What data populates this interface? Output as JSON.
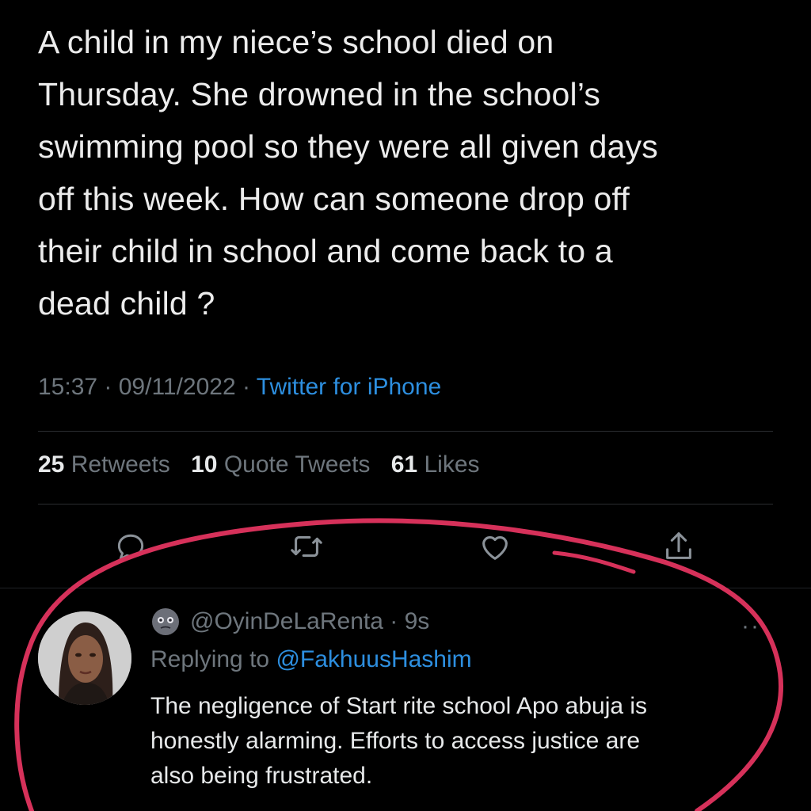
{
  "tweet": {
    "text_lines": [
      "A child in my niece’s school died on",
      "Thursday. She drowned in the school’s",
      "swimming pool so they were all given days",
      "off this week. How can someone drop off",
      "their child in school and come back to a",
      "dead child ?"
    ],
    "time": "15:37",
    "date": "09/11/2022",
    "separator": " · ",
    "source": "Twitter for iPhone",
    "stats": {
      "retweets_count": "25",
      "retweets_label": "Retweets",
      "quotes_count": "10",
      "quotes_label": "Quote Tweets",
      "likes_count": "61",
      "likes_label": "Likes"
    },
    "actions": [
      "reply-icon",
      "retweet-icon",
      "like-icon",
      "share-icon"
    ]
  },
  "reply": {
    "handle": "@OyinDeLaRenta",
    "age": "9s",
    "replying_label": "Replying to",
    "replying_to": "@FakhuusHashim",
    "more": "···",
    "text_lines": [
      "The negligence of Start rite school Apo abuja is",
      "honestly alarming. Efforts to access justice are",
      "also being frustrated."
    ]
  },
  "colors": {
    "background": "#000000",
    "text": "#e7e9ea",
    "muted": "#6e767d",
    "link": "#2d8fe0",
    "annotation": "#d6315a"
  }
}
